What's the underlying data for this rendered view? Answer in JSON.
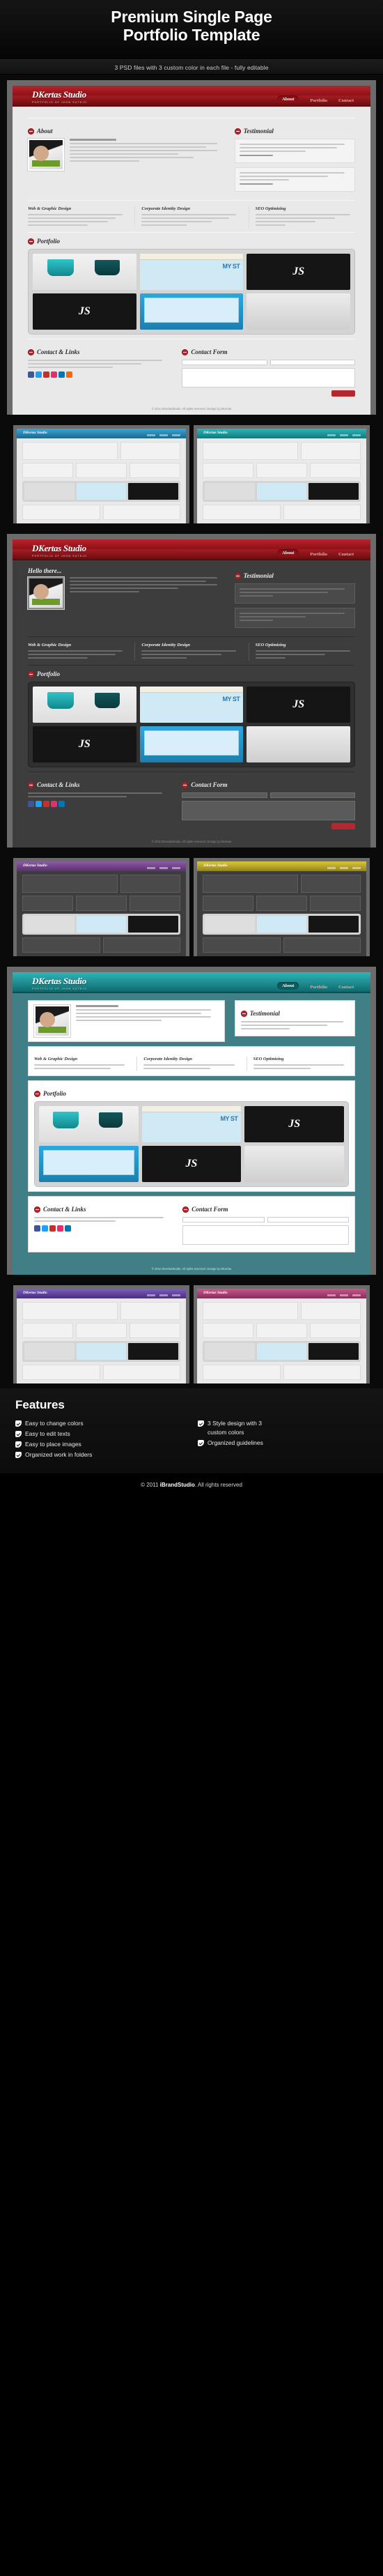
{
  "hero": {
    "title_line1": "Premium Single Page",
    "title_line2": "Portfolio Template",
    "subtitle": "3 PSD files with 3 custom color in each file - fully editable"
  },
  "brand": {
    "logo": "DKertas Studio",
    "tagline": "PORTFOLIO OF JHON SUTEJO"
  },
  "nav": {
    "items": [
      {
        "label": "About",
        "active": true
      },
      {
        "label": "Portfolio",
        "active": false
      },
      {
        "label": "Contact",
        "active": false
      }
    ]
  },
  "sections": {
    "about": "About",
    "testimonial": "Testimonial",
    "portfolio": "Portfolio",
    "contact_links": "Contact & Links",
    "contact_form": "Contact Form",
    "hello": "Hello there..."
  },
  "services": [
    {
      "title": "Web & Graphic Design"
    },
    {
      "title": "Corporate Identity Design"
    },
    {
      "title": "SEO Optimizing"
    }
  ],
  "portfolio_items": [
    {
      "name": "teal-cups-mockup",
      "kind": "cups",
      "label": ""
    },
    {
      "name": "my-story-site",
      "kind": "site",
      "label": "MY ST"
    },
    {
      "name": "js-dark-card",
      "kind": "dark",
      "label": "JS"
    },
    {
      "name": "business-card",
      "kind": "card",
      "label": ""
    },
    {
      "name": "blue-website",
      "kind": "blue",
      "label": ""
    }
  ],
  "portfolio_items_alt": [
    {
      "name": "teal-cups-mockup",
      "kind": "cups",
      "label": ""
    },
    {
      "name": "notebook-my-story",
      "kind": "site",
      "label": "MY ST"
    },
    {
      "name": "js-dark-logo",
      "kind": "dark",
      "label": "JS"
    },
    {
      "name": "blue-web-mock",
      "kind": "blue",
      "label": ""
    },
    {
      "name": "js-dark-card-2",
      "kind": "dark",
      "label": "JS"
    }
  ],
  "page_footer_note": "© 2011 DKertasStudio. All rights reserved. Design by DKertas",
  "variant_rows": [
    {
      "name": "light-variants",
      "cards": [
        {
          "theme": "th-blue",
          "label": "DKertas Studio",
          "dark": false
        },
        {
          "theme": "th-teal",
          "label": "DKertas Studio",
          "dark": false
        }
      ]
    },
    {
      "name": "dark-variants",
      "cards": [
        {
          "theme": "th-purple",
          "label": "DKertas Studio",
          "dark": true
        },
        {
          "theme": "th-yellow",
          "label": "DKertas Studio",
          "dark": true
        }
      ]
    },
    {
      "name": "colored-variants",
      "cards": [
        {
          "theme": "th-violet",
          "label": "DKertas Studio",
          "dark": false
        },
        {
          "theme": "th-pink",
          "label": "DKertas Studio",
          "dark": false
        }
      ]
    }
  ],
  "features": {
    "heading": "Features",
    "col1": [
      "Easy to change colors",
      "Easy to edit texts",
      "Easy to place images",
      "Organized work in folders"
    ],
    "col2": [
      "3 Style design with 3 custom colors",
      "Organized guidelines"
    ]
  },
  "copyright": {
    "prefix": "© 2011 ",
    "brand": "iBrandStudio",
    "suffix": ". All rights reserved"
  },
  "colors": {
    "accent_red": "#b5272d",
    "page_bg": "#e9e9e9",
    "dark_bg": "#0a0a0a",
    "teal_stage": "#3f7f85"
  },
  "social_colors": [
    "#3b5998",
    "#1da1f2",
    "#c4302b",
    "#e1306c",
    "#0077b5",
    "#ff6600"
  ]
}
